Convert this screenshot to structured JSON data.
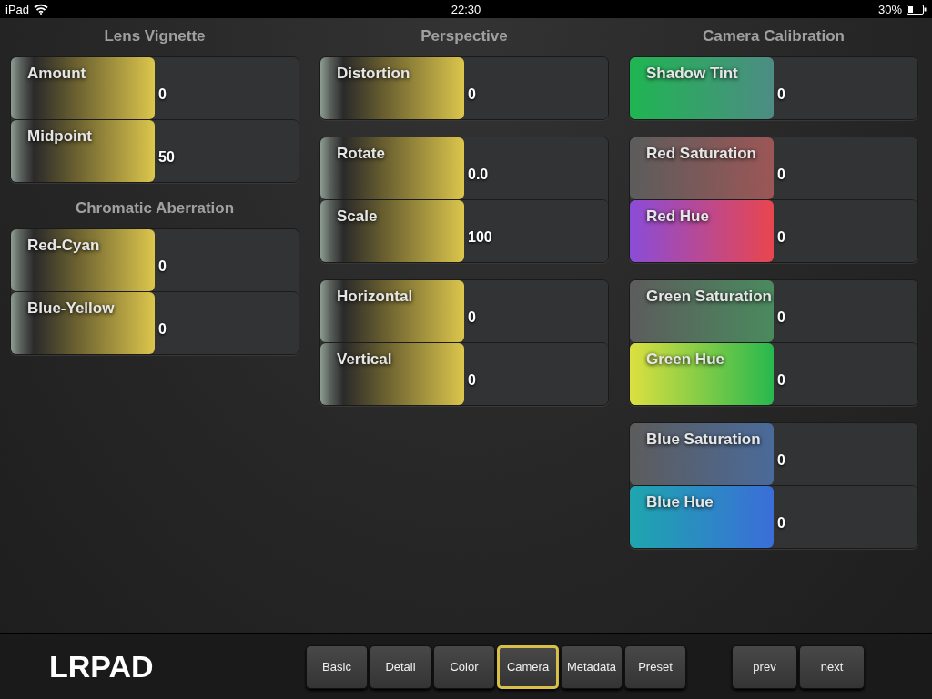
{
  "status_bar": {
    "device": "iPad",
    "time": "22:30",
    "battery": "30%"
  },
  "columns": [
    {
      "sections": [
        {
          "title": "Lens Vignette",
          "groups": [
            [
              {
                "label": "Amount",
                "value": "0",
                "kind": "yellow",
                "level": 0.5
              },
              {
                "label": "Midpoint",
                "value": "50",
                "kind": "yellow",
                "level": 0.5
              }
            ]
          ]
        },
        {
          "title": "Chromatic Aberration",
          "groups": [
            [
              {
                "label": "Red-Cyan",
                "value": "0",
                "kind": "yellow",
                "level": 0.5
              },
              {
                "label": "Blue-Yellow",
                "value": "0",
                "kind": "yellow",
                "level": 0.5
              }
            ]
          ]
        }
      ]
    },
    {
      "sections": [
        {
          "title": "Perspective",
          "groups": [
            [
              {
                "label": "Distortion",
                "value": "0",
                "kind": "yellow",
                "level": 0.5
              }
            ],
            [
              {
                "label": "Rotate",
                "value": "0.0",
                "kind": "yellow",
                "level": 0.5
              },
              {
                "label": "Scale",
                "value": "100",
                "kind": "yellow",
                "level": 0.5
              }
            ],
            [
              {
                "label": "Horizontal",
                "value": "0",
                "kind": "yellow",
                "level": 0.5
              },
              {
                "label": "Vertical",
                "value": "0",
                "kind": "yellow",
                "level": 0.5
              }
            ]
          ]
        }
      ]
    },
    {
      "sections": [
        {
          "title": "Camera Calibration",
          "groups": [
            [
              {
                "label": "Shadow Tint",
                "value": "0",
                "kind": "tint",
                "level": 0.5
              }
            ],
            [
              {
                "label": "Red Saturation",
                "value": "0",
                "kind": "red-sat",
                "level": 0.5
              },
              {
                "label": "Red Hue",
                "value": "0",
                "kind": "red-hue",
                "level": 0.5
              }
            ],
            [
              {
                "label": "Green Saturation",
                "value": "0",
                "kind": "green-sat",
                "level": 0.5
              },
              {
                "label": "Green Hue",
                "value": "0",
                "kind": "green-hue",
                "level": 0.5
              }
            ],
            [
              {
                "label": "Blue Saturation",
                "value": "0",
                "kind": "blue-sat",
                "level": 0.5
              },
              {
                "label": "Blue Hue",
                "value": "0",
                "kind": "blue-hue",
                "level": 0.5
              }
            ]
          ]
        }
      ]
    }
  ],
  "logo": "LRPAD",
  "tabs": [
    {
      "label": "Basic",
      "selected": false
    },
    {
      "label": "Detail",
      "selected": false
    },
    {
      "label": "Color",
      "selected": false
    },
    {
      "label": "Camera",
      "selected": true
    },
    {
      "label": "Metadata",
      "selected": false
    },
    {
      "label": "Preset",
      "selected": false
    }
  ],
  "nav_buttons": [
    "prev",
    "next"
  ]
}
